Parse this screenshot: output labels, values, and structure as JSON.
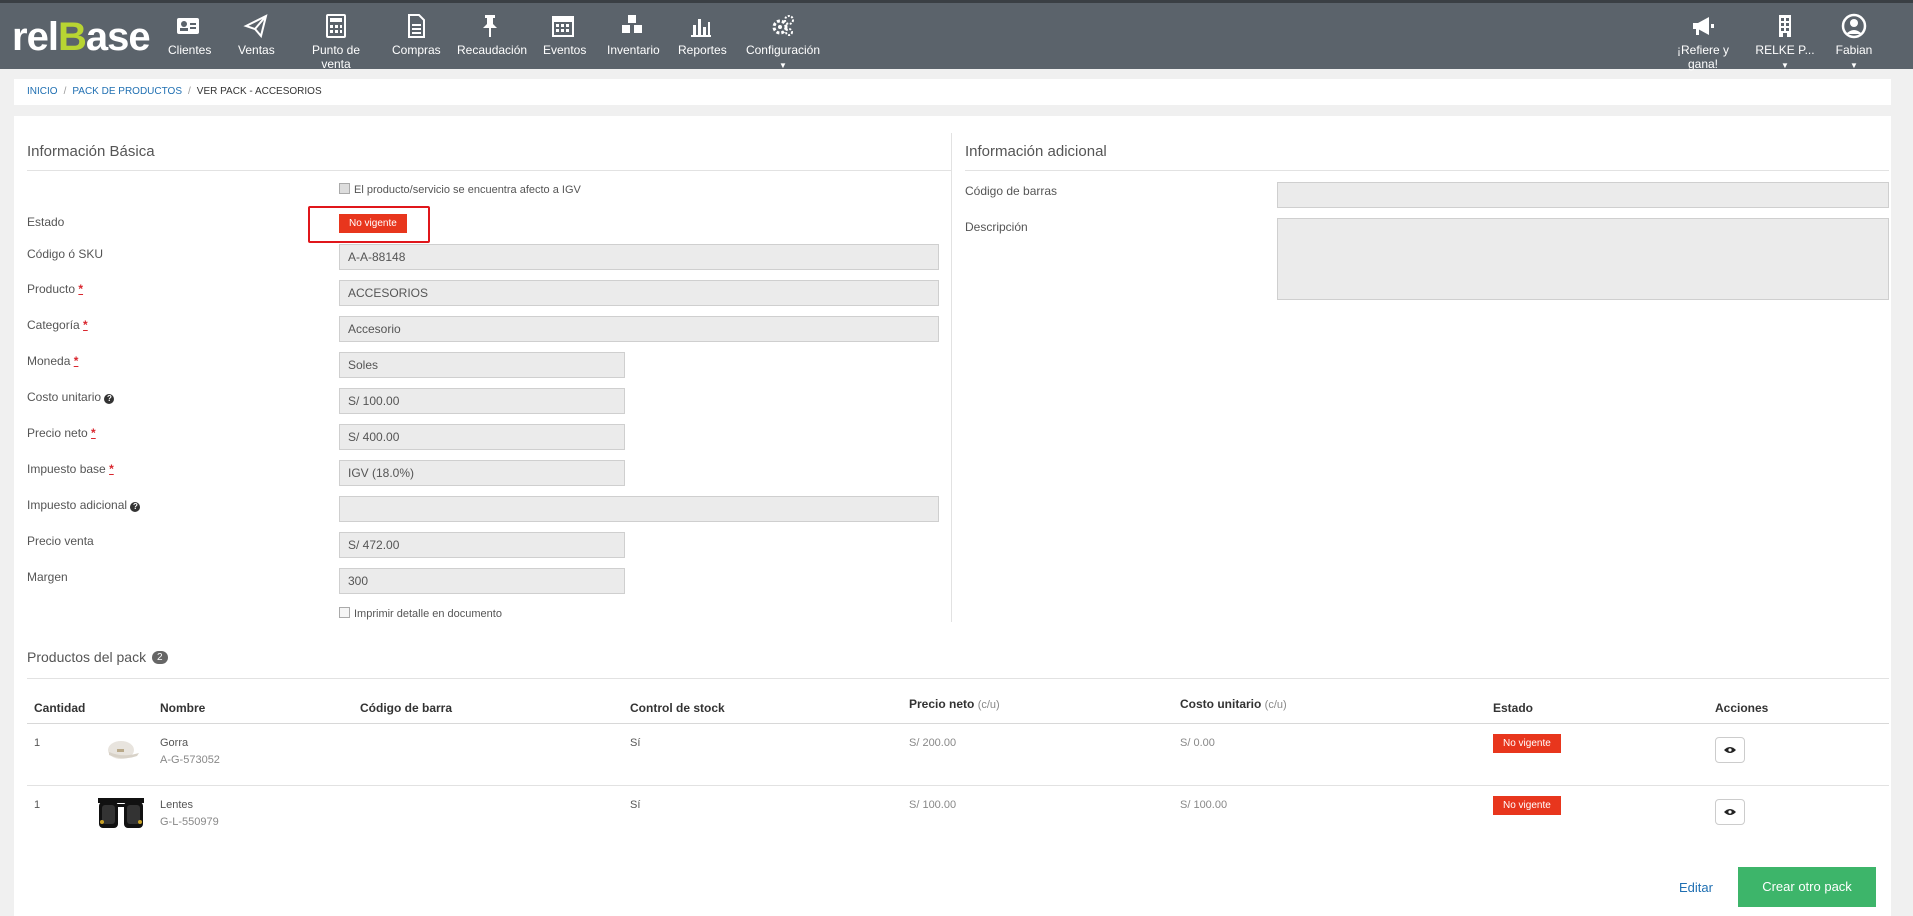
{
  "brand": {
    "logo_pre": "rel",
    "logo_b": "B",
    "logo_post": "ase",
    "accent": "#b8d432"
  },
  "nav": {
    "items": [
      {
        "label": "Clientes",
        "icon": "id-card-icon"
      },
      {
        "label": "Ventas",
        "icon": "paper-plane-icon"
      },
      {
        "label": "Punto de venta",
        "icon": "calculator-icon"
      },
      {
        "label": "Compras",
        "icon": "document-icon"
      },
      {
        "label": "Recaudación",
        "icon": "pushpin-icon"
      },
      {
        "label": "Eventos",
        "icon": "calendar-icon"
      },
      {
        "label": "Inventario",
        "icon": "cubes-icon"
      },
      {
        "label": "Reportes",
        "icon": "bar-chart-icon"
      },
      {
        "label": "Configuración",
        "icon": "gears-icon"
      }
    ],
    "right": [
      {
        "label": "¡Refiere y gana!",
        "icon": "megaphone-icon"
      },
      {
        "label": "RELKE P...",
        "icon": "building-icon"
      },
      {
        "label": "Fabian",
        "icon": "user-circle-icon"
      }
    ]
  },
  "breadcrumb": {
    "home": "INICIO",
    "section": "PACK DE PRODUCTOS",
    "current": "VER PACK - ACCESORIOS"
  },
  "basic": {
    "title": "Información Básica",
    "igv_checkbox": "El producto/servicio se encuentra afecto a IGV",
    "estado_label": "Estado",
    "estado_value": "No vigente",
    "sku_label": "Código ó SKU",
    "sku_value": "A-A-88148",
    "producto_label": "Producto",
    "producto_value": "ACCESORIOS",
    "categoria_label": "Categoría",
    "categoria_value": "Accesorio",
    "moneda_label": "Moneda",
    "moneda_value": "Soles",
    "costo_label": "Costo unitario",
    "costo_value": "S/ 100.00",
    "precio_neto_label": "Precio neto",
    "precio_neto_value": "S/ 400.00",
    "impuesto_base_label": "Impuesto base",
    "impuesto_base_value": "IGV (18.0%)",
    "impuesto_adicional_label": "Impuesto adicional",
    "impuesto_adicional_value": "",
    "precio_venta_label": "Precio venta",
    "precio_venta_value": "S/ 472.00",
    "margen_label": "Margen",
    "margen_value": "300",
    "imprimir_checkbox": "Imprimir detalle en documento",
    "required_mark": "*"
  },
  "additional": {
    "title": "Información adicional",
    "barcode_label": "Código de barras",
    "descripcion_label": "Descripción"
  },
  "pack": {
    "title": "Productos del pack",
    "count": "2",
    "headers": {
      "cantidad": "Cantidad",
      "nombre": "Nombre",
      "codigo_barra": "Código de barra",
      "control_stock": "Control de stock",
      "precio_neto": "Precio neto",
      "costo_unitario": "Costo unitario",
      "unit_suffix": "(c/u)",
      "estado": "Estado",
      "acciones": "Acciones"
    },
    "rows": [
      {
        "cantidad": "1",
        "nombre": "Gorra",
        "codigo": "A-G-573052",
        "stock": "Sí",
        "precio_neto": "S/ 200.00",
        "costo": "S/ 0.00",
        "estado": "No vigente"
      },
      {
        "cantidad": "1",
        "nombre": "Lentes",
        "codigo": "G-L-550979",
        "stock": "Sí",
        "precio_neto": "S/ 100.00",
        "costo": "S/ 100.00",
        "estado": "No vigente"
      }
    ]
  },
  "footer": {
    "edit": "Editar",
    "create": "Crear otro pack"
  }
}
